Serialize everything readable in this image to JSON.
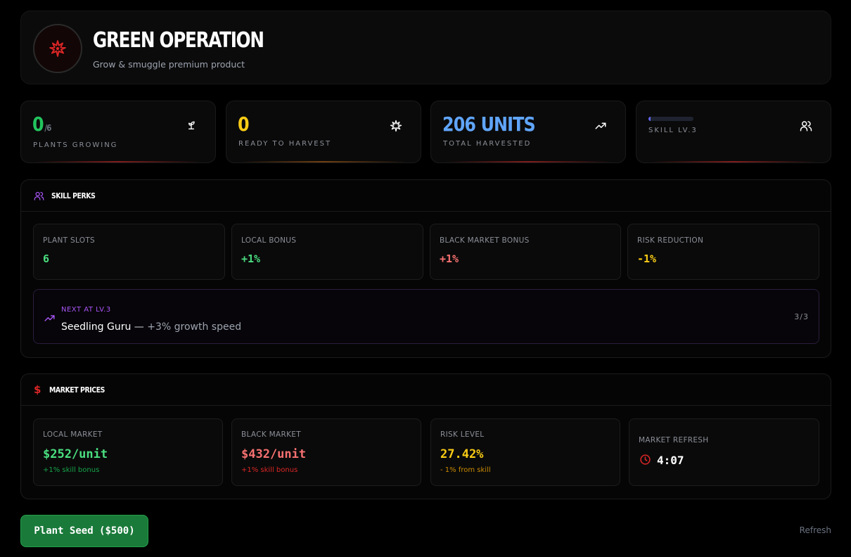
{
  "header": {
    "title": "GREEN OPERATION",
    "subtitle": "Grow & smuggle premium product"
  },
  "stats": [
    {
      "value": "0",
      "suffix": "/6",
      "label": "PLANTS GROWING",
      "icon": "sprout-icon",
      "color": "#22c55e"
    },
    {
      "value": "0",
      "suffix": "",
      "label": "READY TO HARVEST",
      "icon": "leaf-icon",
      "color": "#facc15"
    },
    {
      "value": "206 UNITS",
      "suffix": "",
      "label": "TOTAL HARVESTED",
      "icon": "trending-up-icon",
      "color": "#60a5fa"
    },
    {
      "value": "",
      "suffix": "",
      "label": "SKILL LV.3",
      "icon": "users-icon",
      "color": "#6366f1",
      "progress": 0.05
    }
  ],
  "skill_perks": {
    "title": "SKILL PERKS",
    "cells": [
      {
        "label": "PLANT SLOTS",
        "value": "6",
        "color": "#4ade80"
      },
      {
        "label": "LOCAL BONUS",
        "value": "+1%",
        "color": "#4ade80"
      },
      {
        "label": "BLACK MARKET BONUS",
        "value": "+1%",
        "color": "#f87171"
      },
      {
        "label": "RISK REDUCTION",
        "value": "-1%",
        "color": "#facc15"
      }
    ],
    "next": {
      "label": "NEXT AT LV.3",
      "perk": "Seedling Guru",
      "dash": " — ",
      "effect": "+3% growth speed",
      "count": "3/3"
    }
  },
  "market": {
    "title": "MARKET PRICES",
    "cells": [
      {
        "label": "LOCAL MARKET",
        "value": "$252/unit",
        "note": "+1% skill bonus",
        "color": "#4ade80",
        "note_color": "#16a34a"
      },
      {
        "label": "BLACK MARKET",
        "value": "$432/unit",
        "note": "+1% skill bonus",
        "color": "#f87171",
        "note_color": "#dc2626"
      },
      {
        "label": "RISK LEVEL",
        "value": "27.42%",
        "note": "- 1% from skill",
        "color": "#facc15",
        "note_color": "#ca8a04"
      },
      {
        "label": "MARKET REFRESH",
        "value": "4:07",
        "note": "",
        "color": "#ffffff",
        "note_color": "#ffffff"
      }
    ]
  },
  "actions": {
    "plant_seed": "Plant Seed ($500)",
    "refresh": "Refresh"
  },
  "colors": {
    "accent_red": "#dc2626",
    "accent_green": "#22c55e",
    "accent_purple": "#a855f7"
  }
}
